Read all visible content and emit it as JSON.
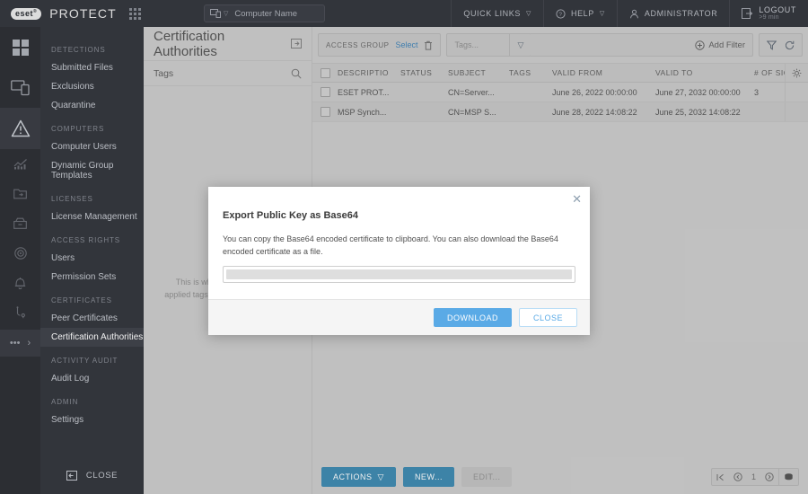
{
  "topbar": {
    "brand_badge": "eset",
    "brand_name": "PROTECT",
    "computer_search_placeholder": "Computer Name",
    "quick_links": "QUICK LINKS",
    "help": "HELP",
    "administrator": "ADMINISTRATOR",
    "logout": "LOGOUT",
    "logout_timer": ">9 min"
  },
  "nav": {
    "groups": [
      {
        "label": "DETECTIONS",
        "items": [
          {
            "label": "Submitted Files",
            "active": false
          },
          {
            "label": "Exclusions",
            "active": false
          },
          {
            "label": "Quarantine",
            "active": false
          }
        ]
      },
      {
        "label": "COMPUTERS",
        "items": [
          {
            "label": "Computer Users",
            "active": false
          },
          {
            "label": "Dynamic Group Templates",
            "active": false
          }
        ]
      },
      {
        "label": "LICENSES",
        "items": [
          {
            "label": "License Management",
            "active": false
          }
        ]
      },
      {
        "label": "ACCESS RIGHTS",
        "items": [
          {
            "label": "Users",
            "active": false
          },
          {
            "label": "Permission Sets",
            "active": false
          }
        ]
      },
      {
        "label": "CERTIFICATES",
        "items": [
          {
            "label": "Peer Certificates",
            "active": false
          },
          {
            "label": "Certification Authorities",
            "active": true
          }
        ]
      },
      {
        "label": "ACTIVITY AUDIT",
        "items": [
          {
            "label": "Audit Log",
            "active": false
          }
        ]
      },
      {
        "label": "ADMIN",
        "items": [
          {
            "label": "Settings",
            "active": false
          }
        ]
      }
    ],
    "close_label": "CLOSE"
  },
  "tags_panel": {
    "page_title": "Certification Authorities",
    "tags_label": "Tags",
    "empty_text": "This is where you can see all applied tags and quickly filter them."
  },
  "filterbar": {
    "access_group_label": "ACCESS GROUP",
    "access_group_select": "Select",
    "tags_placeholder": "Tags...",
    "add_filter": "Add Filter"
  },
  "table": {
    "columns": [
      "DESCRIPTIO",
      "STATUS",
      "SUBJECT",
      "TAGS",
      "VALID FROM",
      "VALID TO",
      "# OF SIGNE"
    ],
    "rows": [
      {
        "description": "ESET PROT...",
        "status": "",
        "subject": "CN=Server...",
        "tags": "",
        "valid_from": "June 26, 2022 00:00:00",
        "valid_to": "June 27, 2032 00:00:00",
        "num_signed": "3"
      },
      {
        "description": "MSP Synch...",
        "status": "",
        "subject": "CN=MSP S...",
        "tags": "",
        "valid_from": "June 28, 2022 14:08:22",
        "valid_to": "June 25, 2032 14:08:22",
        "num_signed": ""
      }
    ]
  },
  "bottombar": {
    "actions": "ACTIONS",
    "new": "NEW...",
    "edit": "EDIT...",
    "page_number": "1"
  },
  "modal": {
    "title": "Export Public Key as Base64",
    "description": "You can copy the Base64 encoded certificate to clipboard. You can also download the Base64 encoded certificate as a file.",
    "field_value": "",
    "download_label": "DOWNLOAD",
    "close_label": "CLOSE"
  },
  "colors": {
    "topbar_bg": "#2b2e35",
    "rail_bg": "#24262c",
    "nav_bg": "#2b2e35",
    "content_bg": "#c9c9c9",
    "accent_blue": "#3785ad",
    "modal_primary": "#5aaae6",
    "link_blue": "#3a7fb5"
  }
}
